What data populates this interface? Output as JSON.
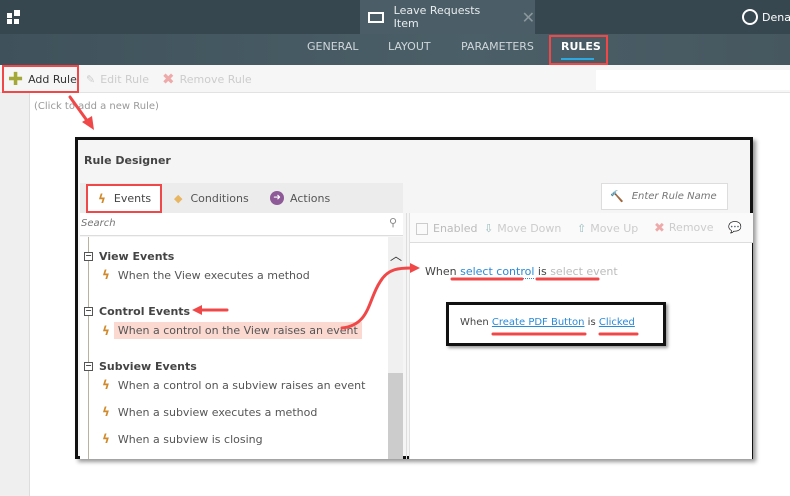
{
  "header": {
    "app_icon": "grid-icon",
    "doc_tab_title": "Leave Requests Item",
    "user_name": "Dena"
  },
  "nav_tabs": [
    {
      "label": "GENERAL"
    },
    {
      "label": "LAYOUT"
    },
    {
      "label": "PARAMETERS"
    },
    {
      "label": "RULES",
      "active": true
    }
  ],
  "toolbar": {
    "add_rule": "Add Rule",
    "edit_rule": "Edit Rule",
    "remove_rule": "Remove Rule"
  },
  "rules_placeholder": "(Click to add a new Rule)",
  "designer": {
    "title": "Rule Designer",
    "tabs": [
      {
        "label": "Events",
        "active": true
      },
      {
        "label": "Conditions"
      },
      {
        "label": "Actions"
      }
    ],
    "search_placeholder": "Search",
    "groups": [
      {
        "label": "View Events",
        "items": [
          "When the View executes a method"
        ]
      },
      {
        "label": "Control Events",
        "items": [
          "When a control on the View raises an event"
        ]
      },
      {
        "label": "Subview Events",
        "items": [
          "When a control on a subview raises an event",
          "When a subview executes a method",
          "When a subview is closing"
        ]
      }
    ],
    "rule_name_placeholder": "Enter Rule Name",
    "right_toolbar": {
      "enabled": "Enabled",
      "move_down": "Move Down",
      "move_up": "Move Up",
      "remove": "Remove"
    },
    "rule_text": {
      "when": "When",
      "control": "select control",
      "is": "is",
      "event": "select event"
    },
    "callout": {
      "when": "When",
      "control": "Create PDF Button",
      "is": "is",
      "event": "Clicked"
    }
  },
  "colors": {
    "accent": "#2ea8e0",
    "highlight": "#f04848",
    "event_icon": "#d08a2c"
  }
}
